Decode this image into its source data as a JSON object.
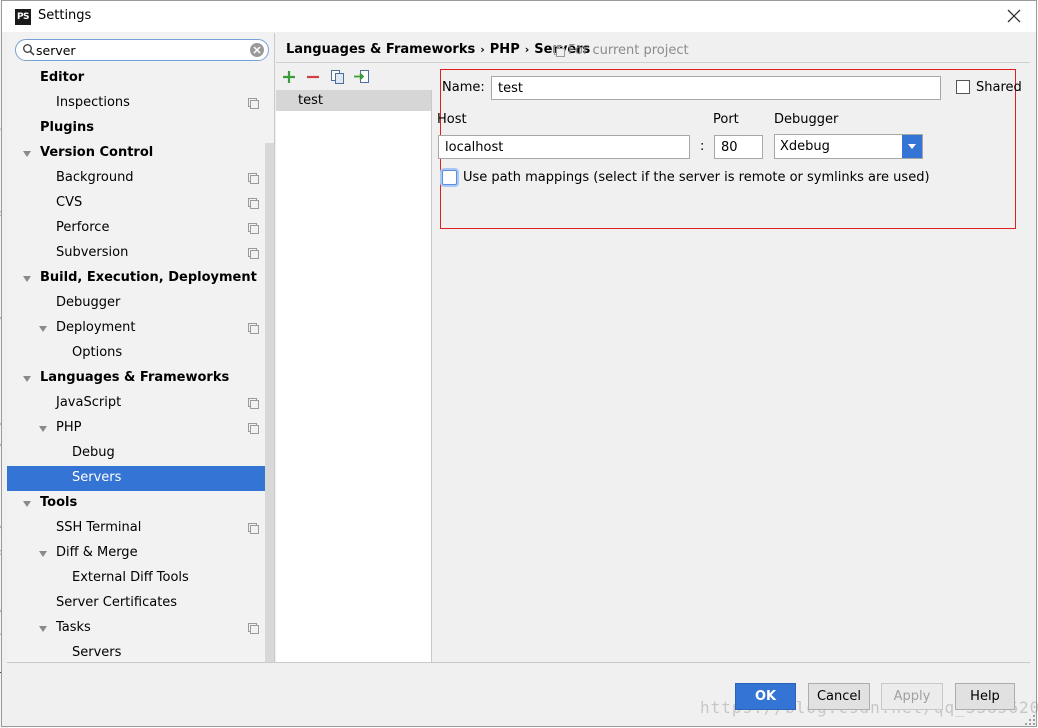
{
  "window": {
    "title": "Settings",
    "app_icon": "PS"
  },
  "search": {
    "value": "server"
  },
  "tree": [
    {
      "label": "Editor",
      "bold": true,
      "level": 0,
      "arrow": "none",
      "project": false
    },
    {
      "label": "Inspections",
      "bold": false,
      "level": 1,
      "arrow": "none",
      "project": true
    },
    {
      "label": "Plugins",
      "bold": true,
      "level": 0,
      "arrow": "none",
      "project": false
    },
    {
      "label": "Version Control",
      "bold": true,
      "level": 0,
      "arrow": "down",
      "project": false
    },
    {
      "label": "Background",
      "bold": false,
      "level": 1,
      "arrow": "none",
      "project": true
    },
    {
      "label": "CVS",
      "bold": false,
      "level": 1,
      "arrow": "none",
      "project": true
    },
    {
      "label": "Perforce",
      "bold": false,
      "level": 1,
      "arrow": "none",
      "project": true
    },
    {
      "label": "Subversion",
      "bold": false,
      "level": 1,
      "arrow": "none",
      "project": true
    },
    {
      "label": "Build, Execution, Deployment",
      "bold": true,
      "level": 0,
      "arrow": "down",
      "project": false
    },
    {
      "label": "Debugger",
      "bold": false,
      "level": 1,
      "arrow": "none",
      "project": false
    },
    {
      "label": "Deployment",
      "bold": false,
      "level": 1,
      "arrow": "down",
      "project": true
    },
    {
      "label": "Options",
      "bold": false,
      "level": 2,
      "arrow": "none",
      "project": false
    },
    {
      "label": "Languages & Frameworks",
      "bold": true,
      "level": 0,
      "arrow": "down",
      "project": false
    },
    {
      "label": "JavaScript",
      "bold": false,
      "level": 1,
      "arrow": "none",
      "project": true
    },
    {
      "label": "PHP",
      "bold": false,
      "level": 1,
      "arrow": "down",
      "project": true
    },
    {
      "label": "Debug",
      "bold": false,
      "level": 2,
      "arrow": "none",
      "project": false
    },
    {
      "label": "Servers",
      "bold": false,
      "level": 2,
      "arrow": "none",
      "project": false,
      "selected": true
    },
    {
      "label": "Tools",
      "bold": true,
      "level": 0,
      "arrow": "down",
      "project": false
    },
    {
      "label": "SSH Terminal",
      "bold": false,
      "level": 1,
      "arrow": "none",
      "project": true
    },
    {
      "label": "Diff & Merge",
      "bold": false,
      "level": 1,
      "arrow": "down",
      "project": false
    },
    {
      "label": "External Diff Tools",
      "bold": false,
      "level": 2,
      "arrow": "none",
      "project": false
    },
    {
      "label": "Server Certificates",
      "bold": false,
      "level": 1,
      "arrow": "none",
      "project": false
    },
    {
      "label": "Tasks",
      "bold": false,
      "level": 1,
      "arrow": "down",
      "project": true
    },
    {
      "label": "Servers",
      "bold": false,
      "level": 2,
      "arrow": "none",
      "project": false
    }
  ],
  "breadcrumb": {
    "part1": "Languages & Frameworks",
    "sep": "›",
    "part2": "PHP",
    "part3": "Servers"
  },
  "project_note": "For current project",
  "servers_list": [
    "test"
  ],
  "form": {
    "name_label": "Name:",
    "name_value": "test",
    "shared_label": "Shared",
    "shared_checked": false,
    "host_label": "Host",
    "host_value": "localhost",
    "colon": ":",
    "port_label": "Port",
    "port_value": "80",
    "debugger_label": "Debugger",
    "debugger_value": "Xdebug",
    "path_mappings_label": "Use path mappings (select if the server is remote or symlinks are used)",
    "path_mappings_checked": false
  },
  "buttons": {
    "ok": "OK",
    "cancel": "Cancel",
    "apply": "Apply",
    "help": "Help"
  },
  "watermark": "https://blog.csdn.net/qq_33856200",
  "colors": {
    "accent": "#3474d4",
    "add": "#3a9b3a",
    "remove": "#d04040",
    "highlight_box": "#e02020"
  },
  "background_fragments": [
    "N",
    "-0",
    "is",
    "is",
    "s",
    "el",
    "nl",
    "nl",
    "el",
    "c",
    "is",
    "cl",
    "s",
    "il",
    "c.",
    "a",
    "M",
    "Ta"
  ]
}
